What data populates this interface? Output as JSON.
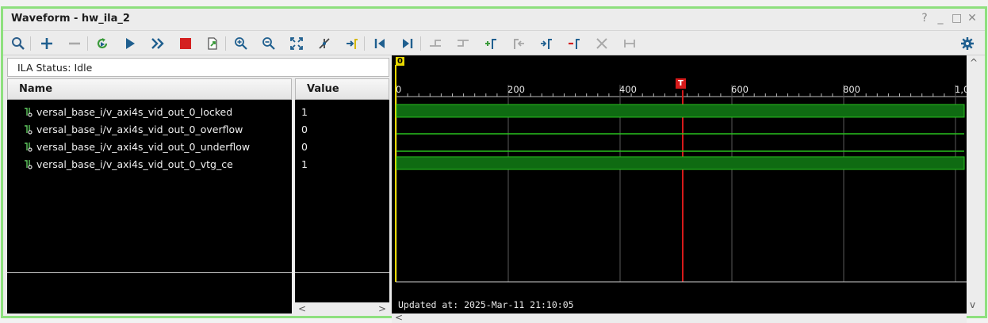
{
  "window": {
    "title": "Waveform - hw_ila_2",
    "controls": [
      "?",
      "_",
      "□",
      "✕"
    ]
  },
  "toolbar": {
    "icons": [
      "search-icon",
      "add-icon",
      "remove-icon",
      "run-trigger-icon",
      "run-icon",
      "run-immediate-icon",
      "stop-icon",
      "export-icon",
      "zoom-in-icon",
      "zoom-out-icon",
      "zoom-fit-icon",
      "cursor-icon",
      "go-to-marker-icon",
      "go-to-start-icon",
      "go-to-end-icon",
      "previous-transition-icon",
      "next-transition-icon",
      "add-marker-icon",
      "previous-marker-icon",
      "next-marker-icon",
      "delete-marker-icon",
      "swap-cursor-icon",
      "marker-distance-icon",
      "settings-icon"
    ]
  },
  "status": {
    "text": "ILA Status: Idle"
  },
  "columns": {
    "name": "Name",
    "value": "Value"
  },
  "signals": [
    {
      "name": "versal_base_i/v_axi4s_vid_out_0_locked",
      "value": "1"
    },
    {
      "name": "versal_base_i/v_axi4s_vid_out_0_overflow",
      "value": "0"
    },
    {
      "name": "versal_base_i/v_axi4s_vid_out_0_underflow",
      "value": "0"
    },
    {
      "name": "versal_base_i/v_axi4s_vid_out_0_vtg_ce",
      "value": "1"
    }
  ],
  "waveform": {
    "cursor_marker": "0",
    "trigger_marker": "T",
    "ticks": [
      "0",
      "200",
      "400",
      "600",
      "800",
      "1,0"
    ],
    "updated": "Updated at: 2025-Mar-11 21:10:05",
    "colors": {
      "high": "#0f6b12",
      "edge": "#29c21f",
      "trigger": "#d61a1a",
      "grid": "#5a5a5a"
    }
  }
}
